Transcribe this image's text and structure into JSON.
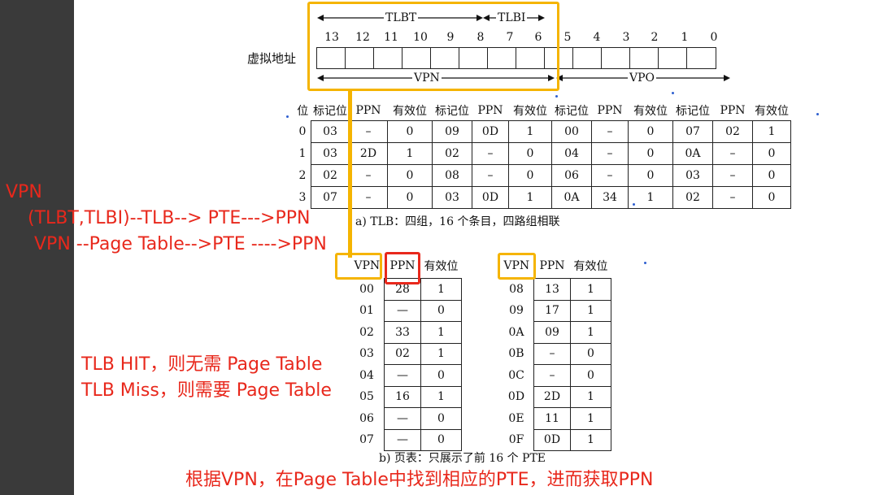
{
  "bit_numbers": [
    "13",
    "12",
    "11",
    "10",
    "9",
    "8",
    "7",
    "6",
    "5",
    "4",
    "3",
    "2",
    "1",
    "0"
  ],
  "register_label": "虚拟地址",
  "tlbt_label": "TLBT",
  "tlbi_label": "TLBI",
  "vpn_label": "VPN",
  "vpo_label": "VPO",
  "tlb": {
    "headers": [
      "位",
      "标记位",
      "PPN",
      "有效位",
      "标记位",
      "PPN",
      "有效位",
      "标记位",
      "PPN",
      "有效位",
      "标记位",
      "PPN",
      "有效位"
    ],
    "rows": [
      [
        "0",
        "03",
        "–",
        "0",
        "09",
        "0D",
        "1",
        "00",
        "–",
        "0",
        "07",
        "02",
        "1"
      ],
      [
        "1",
        "03",
        "2D",
        "1",
        "02",
        "–",
        "0",
        "04",
        "–",
        "0",
        "0A",
        "–",
        "0"
      ],
      [
        "2",
        "02",
        "–",
        "0",
        "08",
        "–",
        "0",
        "06",
        "–",
        "0",
        "03",
        "–",
        "0"
      ],
      [
        "3",
        "07",
        "–",
        "0",
        "03",
        "0D",
        "1",
        "0A",
        "34",
        "1",
        "02",
        "–",
        "0"
      ]
    ],
    "caption": "a) TLB：四组，16 个条目，四路组相联"
  },
  "page_table": {
    "headers": [
      "VPN",
      "PPN",
      "有效位"
    ],
    "left_rows": [
      [
        "00",
        "28",
        "1"
      ],
      [
        "01",
        "—",
        "0"
      ],
      [
        "02",
        "33",
        "1"
      ],
      [
        "03",
        "02",
        "1"
      ],
      [
        "04",
        "—",
        "0"
      ],
      [
        "05",
        "16",
        "1"
      ],
      [
        "06",
        "—",
        "0"
      ],
      [
        "07",
        "—",
        "0"
      ]
    ],
    "right_rows": [
      [
        "08",
        "13",
        "1"
      ],
      [
        "09",
        "17",
        "1"
      ],
      [
        "0A",
        "09",
        "1"
      ],
      [
        "0B",
        "–",
        "0"
      ],
      [
        "0C",
        "–",
        "0"
      ],
      [
        "0D",
        "2D",
        "1"
      ],
      [
        "0E",
        "11",
        "1"
      ],
      [
        "0F",
        "0D",
        "1"
      ]
    ],
    "caption": "b) 页表：只展示了前 16 个 PTE"
  },
  "annotations": {
    "vpn": "VPN",
    "tlb_path": "(TLBT,TLBI)--TLB--> PTE--->PPN",
    "pt_path": "VPN --Page Table-->PTE ---->PPN",
    "hit": "TLB HIT，则无需 Page Table",
    "miss": "TLB Miss，则需要 Page Table",
    "bottom": "根据VPN，在Page Table中找到相应的PTE，进而获取PPN"
  },
  "colors": {
    "annotation": "#e8281c",
    "highlight": "#f5b400",
    "sidebar": "#3a3a3a"
  }
}
